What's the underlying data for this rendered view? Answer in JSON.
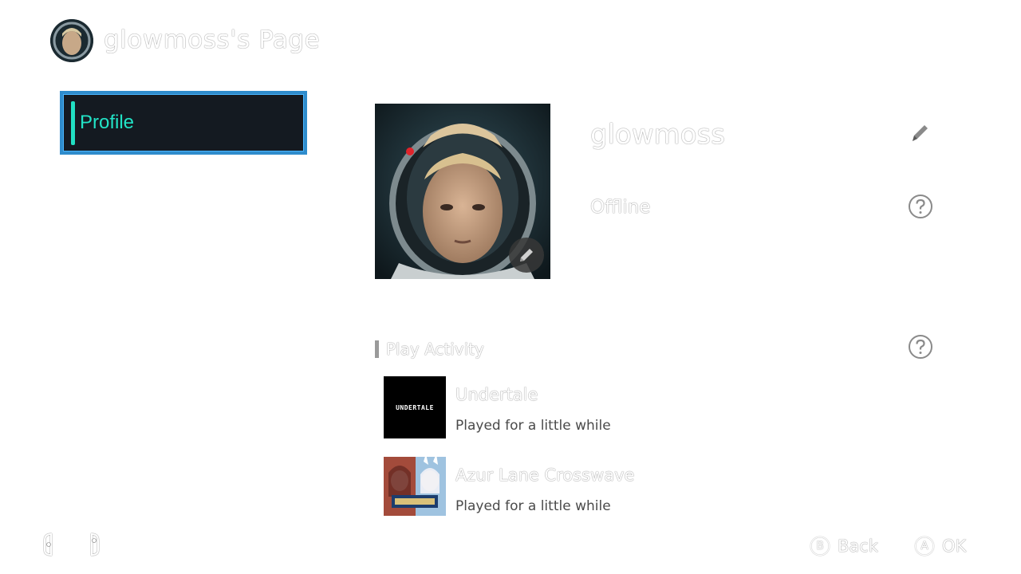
{
  "header": {
    "title": "glowmoss's Page"
  },
  "sidebar": {
    "items": [
      {
        "label": "Profile"
      }
    ]
  },
  "profile": {
    "username": "glowmoss",
    "status": "Offline"
  },
  "play_activity": {
    "title": "Play Activity",
    "games": [
      {
        "title": "Undertale",
        "subtitle": "Played for a little while",
        "logo_text": "UNDERTALE"
      },
      {
        "title": "Azur Lane Crosswave",
        "subtitle": "Played for a little while"
      }
    ]
  },
  "footer": {
    "actions": [
      {
        "glyph": "B",
        "label": "Back"
      },
      {
        "glyph": "A",
        "label": "OK"
      }
    ]
  },
  "colors": {
    "accent": "#22e3c6",
    "selection_border": "#2f8ccc",
    "sidebar_bg": "#141a21"
  }
}
